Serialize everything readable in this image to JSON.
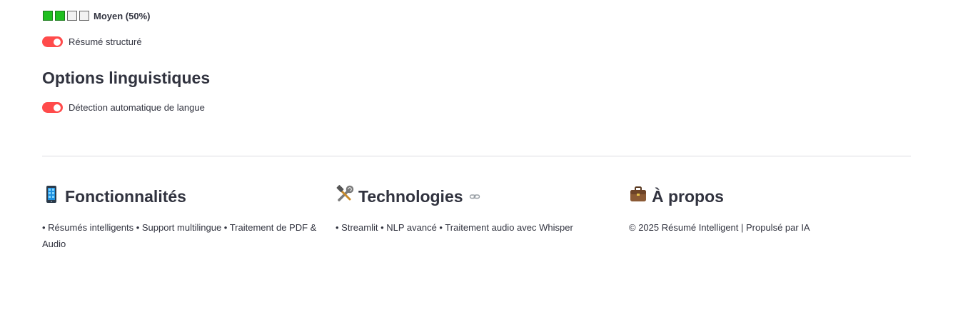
{
  "level": {
    "filled": 2,
    "total": 4,
    "label": "Moyen (50%)",
    "filled_color": "#1fbf1f",
    "empty_color": "#f2f2f2"
  },
  "toggles": [
    {
      "label": "Résumé structuré",
      "checked": true
    },
    {
      "label": "Détection automatique de langue",
      "checked": true
    }
  ],
  "language_section": {
    "title": "Options linguistiques"
  },
  "footer": {
    "features": {
      "icon": "mobile-phone-icon",
      "title": "Fonctionnalités",
      "text": "• Résumés intelligents • Support multilingue • Traitement de PDF & Audio"
    },
    "technologies": {
      "icon": "hammer-wrench-icon",
      "title": "Technologies",
      "text": "• Streamlit • NLP avancé • Traitement audio avec Whisper"
    },
    "about": {
      "icon": "briefcase-icon",
      "title": "À propos",
      "text": "© 2025 Résumé Intelligent | Propulsé par IA"
    }
  },
  "colors": {
    "accent": "#ff4b4b",
    "text": "#31333f",
    "divider": "#dcdde1"
  }
}
